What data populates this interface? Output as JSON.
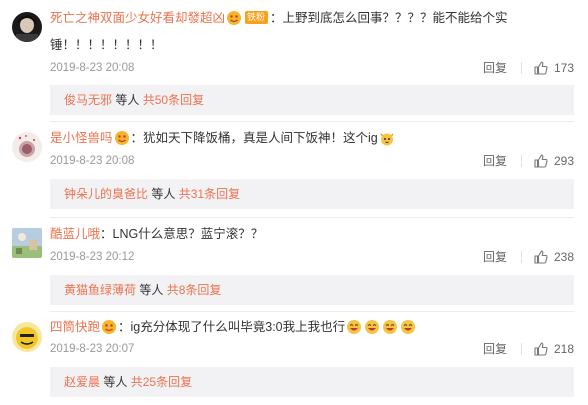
{
  "comments": [
    {
      "username": "死亡之神双面少女好看却發超凶",
      "badge": "铁粉",
      "text_line1": "：上野到底怎么回事？？？？能不能给个实",
      "text_line2": "锤！！！！！！！！",
      "date": "2019-8-23 20:08",
      "reply_label": "回复",
      "likes": "173",
      "sub_names": "俊马无邪",
      "sub_mid": "等人",
      "sub_count": "共50条回复"
    },
    {
      "username": "是小怪兽吗",
      "text": "：犹如天下降饭桶，真是人间下饭神！这个ig",
      "date": "2019-8-23 20:08",
      "reply_label": "回复",
      "likes": "293",
      "sub_names": "钟朵儿的臭爸比",
      "sub_mid": "等人",
      "sub_count": "共31条回复"
    },
    {
      "username": "酷蓝儿哦",
      "text": "：LNG什么意思？蓝宁滚？？",
      "date": "2019-8-23 20:12",
      "reply_label": "回复",
      "likes": "238",
      "sub_names": "黄猫鱼绿薄荷",
      "sub_mid": "等人",
      "sub_count": "共8条回复"
    },
    {
      "username": "四筒快跑",
      "text": "：ig充分体现了什么叫毕竟3:0我上我也行",
      "date": "2019-8-23 20:07",
      "reply_label": "回复",
      "likes": "218",
      "sub_names": "赵爱晨",
      "sub_mid": "等人",
      "sub_count": "共25条回复"
    }
  ],
  "colors": {
    "username": "#eb7350",
    "date": "#999999",
    "sub_bg": "#f2f2f5"
  }
}
